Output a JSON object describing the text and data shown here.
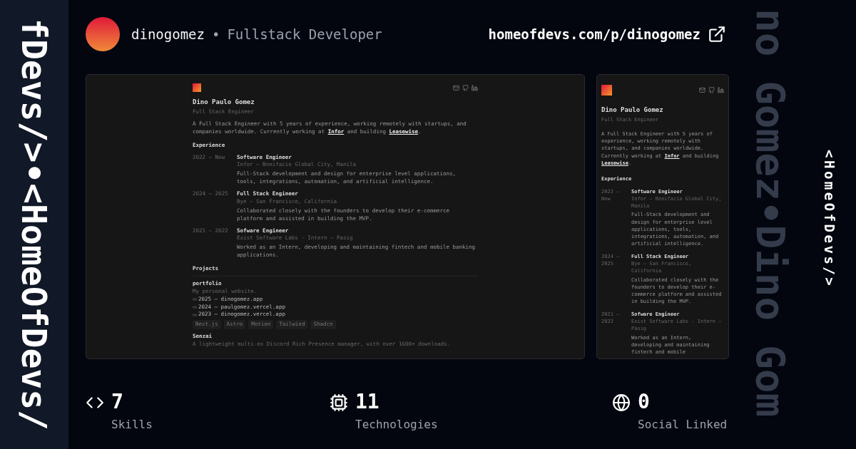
{
  "sidebar": {
    "text": "fDevs/>•<HomeOfDevs/"
  },
  "header": {
    "username": "dinogomez",
    "separator": "•",
    "role": "Fullstack Developer",
    "url": "homeofdevs.com/p/dinogomez"
  },
  "previews": [
    {
      "kind": "desktop",
      "name": "Dino Paulo Gomez",
      "title": "Full Stack Engineer",
      "bio": "A Full Stack Engineer with 5 years of experience, working remotely with startups, and companies worldwide. Currently working at **Infor** and building **Leasewise**.",
      "experience_heading": "Experience",
      "experience": [
        {
          "period": "2022 — Now",
          "role": "Software Engineer",
          "company": "Infor — Bonifacio Global City, Manila",
          "description": "Full-Stack development and design for enterprise level applications, tools, integrations, automation, and artificial intelligence."
        },
        {
          "period": "2024 — 2025",
          "role": "Full Stack Engineer",
          "company": "Bye — San Francisco, California",
          "description": "Collaborated closely with the founders to develop their e-commerce platform and assisted in building the MVP."
        },
        {
          "period": "2021 — 2022",
          "role": "Sofware Engineer",
          "company": "Exist Software Labs - Intern — Pasig",
          "description": "Worked as an Intern, developing and maintaining fintech and mobile banking applications."
        }
      ],
      "projects_heading": "Projects",
      "projects": [
        {
          "name": "portfolio",
          "description": "My personal website.",
          "links": [
            "2025 — dinogomez.app",
            "2024 — paulgomez.vercel.app",
            "2023 — dinogomez.vercel.app"
          ],
          "tags": [
            "Next.js",
            "Astro",
            "Motion",
            "Tailwind",
            "Shadcn"
          ]
        },
        {
          "name": "Senzai",
          "description": "A lightweight multi-os Discord Rich Presence manager, with over 1600+ downloads."
        }
      ]
    },
    {
      "kind": "mobile",
      "name": "Dino Paulo Gomez",
      "title": "Full Stack Engineer",
      "bio": "A Full Stack Engineer with 5 years of experience, working remotely with startups, and companies worldwide. Currently working at **Infor** and building **Leasewise**.",
      "experience_heading": "Experience",
      "experience": [
        {
          "period": "2022 — Now",
          "role": "Software Engineer",
          "company": "Infor — Bonifacio Global City, Manila",
          "description": "Full-Stack development and design for enterprise level applications, tools, integrations, automation, and artificial intelligence."
        },
        {
          "period": "2024 — 2025",
          "role": "Full Stack Engineer",
          "company": "Bye — San Francisco, California",
          "description": "Collaborated closely with the founders to develop their e-commerce platform and assisted in building the MVP."
        },
        {
          "period": "2021 — 2022",
          "role": "Sofware Engineer",
          "company": "Exist Software Labs - Intern — Pasig",
          "description": "Worked as an Intern, developing and maintaining fintech and mobile"
        }
      ]
    }
  ],
  "stats": [
    {
      "kind": "code",
      "value": "7",
      "label": "Skills"
    },
    {
      "kind": "chip",
      "value": "11",
      "label": "Technologies"
    },
    {
      "kind": "globe",
      "value": "0",
      "label": "Social Linked"
    }
  ],
  "backdrop": {
    "text": "no Gomez•Dino Gom"
  },
  "brand": {
    "text": "<HomeOfDevs/>"
  }
}
